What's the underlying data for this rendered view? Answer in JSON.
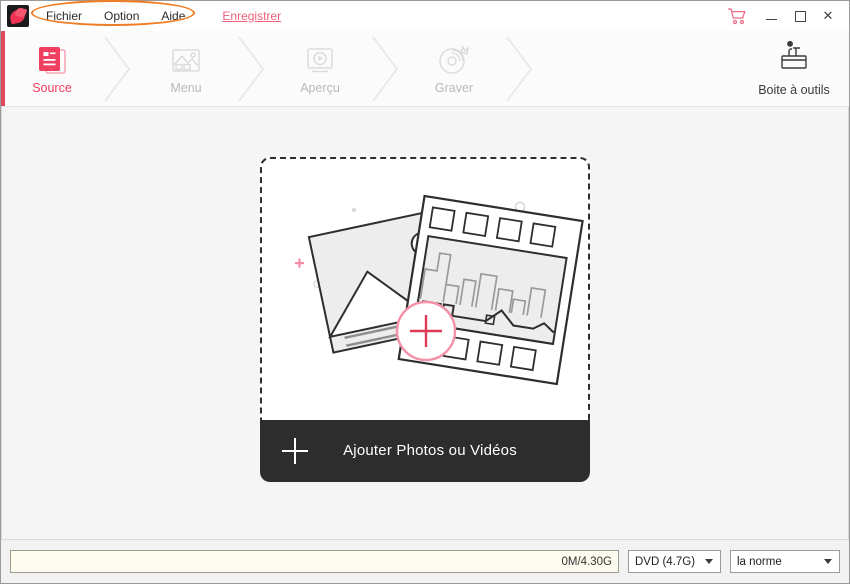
{
  "titlebar": {
    "logo_icon": "app-logo-icon",
    "menus": [
      {
        "label": "Fichier"
      },
      {
        "label": "Option"
      },
      {
        "label": "Aide"
      }
    ],
    "save_link": "Enregistrer",
    "cart_icon": "shopping-cart-icon",
    "minimize_label": "",
    "maximize_label": "",
    "close_label": "✕",
    "highlight_color": "#ef7c22"
  },
  "toolbar": {
    "accent_color": "#e0485f",
    "steps": [
      {
        "label": "Source",
        "icon": "documents-icon",
        "active": true
      },
      {
        "label": "Menu",
        "icon": "image-thumbnails-icon",
        "active": false
      },
      {
        "label": "Aperçu",
        "icon": "monitor-play-icon",
        "active": false
      },
      {
        "label": "Graver",
        "icon": "disc-burn-icon",
        "active": false
      }
    ],
    "toolbox": {
      "label": "Boite à outils",
      "icon": "toolbox-icon"
    }
  },
  "main": {
    "dropzone": {
      "illustration": "photo-and-filmstrip-illustration",
      "add_circle_icon": "plus-circle-icon"
    },
    "add_button": {
      "label": "Ajouter Photos ou Vidéos",
      "icon": "plus-icon"
    }
  },
  "statusbar": {
    "capacity_text": "0M/4.30G",
    "disc_select": {
      "value": "DVD (4.7G)",
      "icon": "chevron-down-icon"
    },
    "quality_select": {
      "value": "la norme",
      "icon": "chevron-down-icon"
    }
  }
}
